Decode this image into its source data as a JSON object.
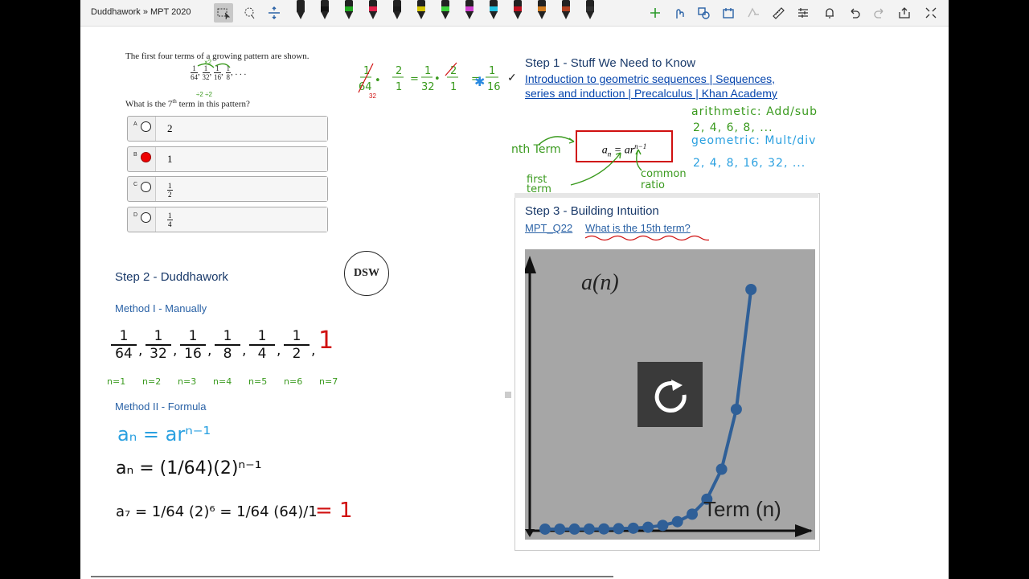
{
  "toolbar": {
    "breadcrumb": "Duddhawork » MPT 2020",
    "pens": [
      "#222222",
      "#111111",
      "#22aa22",
      "#e0204a",
      "#1a1a1a",
      "#d4c400",
      "#3bd23b",
      "#d040d0",
      "#20c0e0",
      "#c01020",
      "#d07a20",
      "#b04020",
      "#303030"
    ]
  },
  "question": {
    "intro": "The first four terms of a growing pattern are shown.",
    "sequence": [
      [
        "1",
        "64"
      ],
      [
        "1",
        "32"
      ],
      [
        "1",
        "16"
      ],
      [
        "1",
        "8"
      ]
    ],
    "ellipsis": ", . . .",
    "prompt_pre": "What is the 7",
    "prompt_sup": "th",
    "prompt_post": " term in this pattern?",
    "choices": [
      {
        "letter": "A",
        "value": "2",
        "selected": false
      },
      {
        "letter": "B",
        "value": "1",
        "selected": true
      },
      {
        "letter": "C",
        "num": "1",
        "den": "2",
        "selected": false
      },
      {
        "letter": "D",
        "num": "1",
        "den": "4",
        "selected": false
      }
    ]
  },
  "step1": {
    "title": "Step 1 - Stuff We Need to Know",
    "check": "✓",
    "link_line1": "Introduction to geometric sequences | Sequences,",
    "link_line2": "series and induction | Precalculus | Khan Academy",
    "formula_base": "a",
    "formula_sub": "n",
    "formula_eq": " = ar",
    "formula_sup": "n−1",
    "hw_nth": "nth Term",
    "hw_first": "first term",
    "hw_ratio": "common ratio",
    "hw_arith": "arithmetic: Add/sub",
    "hw_arith_seq": "2, 4, 6, 8, ...",
    "hw_geo": "geometric: Mult/div",
    "hw_geo_seq": "2, 4, 8, 16, 32, ..."
  },
  "step2": {
    "title": "Step 2 - Duddhawork",
    "logo_text": "DSW",
    "method1": "Method I - Manually",
    "method1_terms": [
      [
        "1",
        "64"
      ],
      [
        "1",
        "32"
      ],
      [
        "1",
        "16"
      ],
      [
        "1",
        "8"
      ],
      [
        "1",
        "4"
      ],
      [
        "1",
        "2"
      ]
    ],
    "method1_answer": "1",
    "method1_labels": [
      "n=1",
      "n=2",
      "n=3",
      "n=4",
      "n=5",
      "n=6",
      "n=7"
    ],
    "method2": "Method II - Formula",
    "formula_line1": "aₙ = arⁿ⁻¹",
    "formula_line2": "aₙ = (1/64)(2)ⁿ⁻¹",
    "formula_line3": "a₇ = 1/64 (2)⁶ = 1/64 (64)/1",
    "formula_answer": "= 1"
  },
  "step3": {
    "title": "Step 3 - Building Intuition",
    "link1": "MPT_Q22",
    "link2": "What is the 15th term?"
  },
  "graph": {
    "ylabel": "a(n)",
    "xlabel": "Term (n)"
  },
  "colors": {
    "accent_green": "#3a9a1e",
    "accent_red": "#d01010",
    "accent_blue": "#1aa0e0",
    "point_blue": "#2f5f97"
  }
}
